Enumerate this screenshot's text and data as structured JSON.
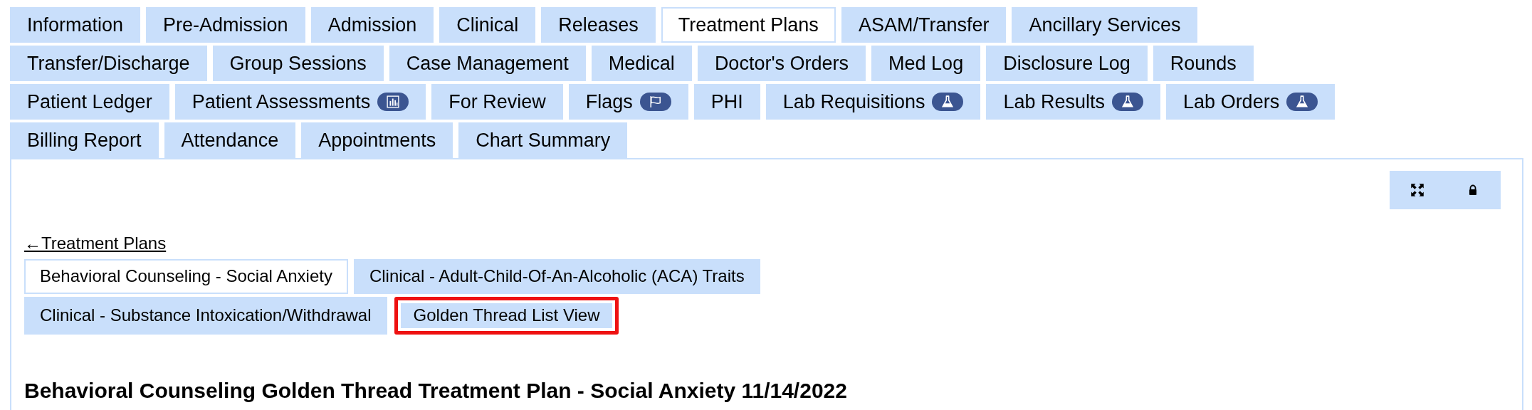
{
  "tab_rows": [
    [
      {
        "label": "Information",
        "selected": false
      },
      {
        "label": "Pre-Admission",
        "selected": false
      },
      {
        "label": "Admission",
        "selected": false
      },
      {
        "label": "Clinical",
        "selected": false
      },
      {
        "label": "Releases",
        "selected": false
      },
      {
        "label": "Treatment Plans",
        "selected": true
      },
      {
        "label": "ASAM/Transfer",
        "selected": false
      },
      {
        "label": "Ancillary Services",
        "selected": false
      }
    ],
    [
      {
        "label": "Transfer/Discharge",
        "selected": false
      },
      {
        "label": "Group Sessions",
        "selected": false
      },
      {
        "label": "Case Management",
        "selected": false
      },
      {
        "label": "Medical",
        "selected": false
      },
      {
        "label": "Doctor's Orders",
        "selected": false
      },
      {
        "label": "Med Log",
        "selected": false
      },
      {
        "label": "Disclosure Log",
        "selected": false
      },
      {
        "label": "Rounds",
        "selected": false
      }
    ],
    [
      {
        "label": "Patient Ledger",
        "selected": false
      },
      {
        "label": "Patient Assessments",
        "selected": false,
        "kind": "chart"
      },
      {
        "label": "For Review",
        "selected": false
      },
      {
        "label": "Flags",
        "selected": false,
        "kind": "flag"
      },
      {
        "label": "PHI",
        "selected": false
      },
      {
        "label": "Lab Requisitions",
        "selected": false,
        "kind": "flask"
      },
      {
        "label": "Lab Results",
        "selected": false,
        "kind": "flask"
      },
      {
        "label": "Lab Orders",
        "selected": false,
        "kind": "flask"
      }
    ],
    [
      {
        "label": "Billing Report",
        "selected": false
      },
      {
        "label": "Attendance",
        "selected": false
      },
      {
        "label": "Appointments",
        "selected": false
      },
      {
        "label": "Chart Summary",
        "selected": false
      }
    ]
  ],
  "toolbar": [
    {
      "kind": "expand"
    },
    {
      "kind": "lock"
    }
  ],
  "back_link": "←Treatment Plans",
  "plan_tab_rows": [
    [
      {
        "label": "Behavioral Counseling - Social Anxiety",
        "selected": true,
        "highlighted": false
      },
      {
        "label": "Clinical - Adult-Child-Of-An-Alcoholic (ACA) Traits",
        "selected": false,
        "highlighted": false
      }
    ],
    [
      {
        "label": "Clinical - Substance Intoxication/Withdrawal",
        "selected": false,
        "highlighted": false
      },
      {
        "label": "Golden Thread List View",
        "selected": false,
        "highlighted": true
      }
    ]
  ],
  "heading": "Behavioral Counseling Golden Thread Treatment Plan - Social Anxiety 11/14/2022"
}
